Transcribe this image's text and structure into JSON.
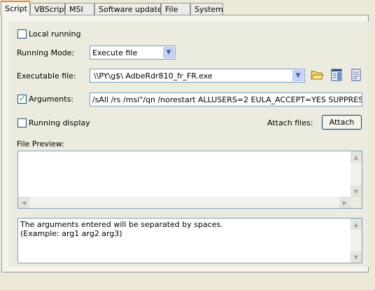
{
  "tabs": [
    {
      "label": "Script",
      "active": true
    },
    {
      "label": "VBScript",
      "active": false
    },
    {
      "label": "MSI",
      "active": false
    },
    {
      "label": "Software update",
      "active": false
    },
    {
      "label": "File",
      "active": false
    },
    {
      "label": "System",
      "active": false
    }
  ],
  "local_running": {
    "label": "Local running",
    "checked": false
  },
  "running_mode": {
    "label": "Running Mode:",
    "value": "Execute file"
  },
  "executable_file": {
    "label": "Executable file:",
    "value": "\\\\PY\\g$\\ AdbeRdr810_fr_FR.exe"
  },
  "arguments": {
    "label": "Arguments:",
    "checked": true,
    "value": "/sAll /rs /msi\"/qn /norestart ALLUSERS=2 EULA_ACCEPT=YES SUPPRESS_APP_LAUNCH=YES\""
  },
  "running_display": {
    "label": "Running display",
    "checked": false
  },
  "attach_files": {
    "label": "Attach files:",
    "button": "Attach"
  },
  "file_preview": {
    "label": "File Preview:"
  },
  "hint": {
    "line1": "The arguments entered will be separated by spaces.",
    "line2": "(Example: arg1 arg2 arg3)"
  },
  "icons": {
    "folder": "folder-open-icon",
    "browse": "browse-window-icon",
    "view": "view-file-icon"
  },
  "colors": {
    "tab_highlight": "#e68b2c",
    "panel_bg": "#ecebe0",
    "check_mark": "#21a121",
    "border_blue": "#7f9db9"
  }
}
